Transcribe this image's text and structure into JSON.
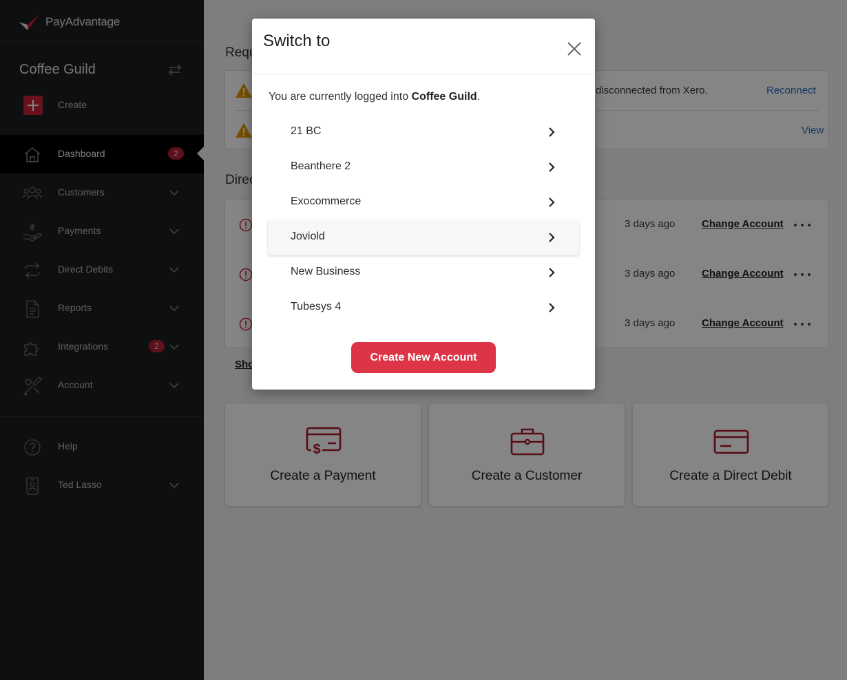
{
  "colors": {
    "sidebar_bg": "#1c1d20",
    "brand_red": "#c8243a",
    "button_red": "#dd3447",
    "link_blue": "#2f6ec1",
    "warning_orange": "#e39a00"
  },
  "sidebar": {
    "logo_text": "PayAdvantage",
    "business_name": "Coffee Guild",
    "create_label": "Create",
    "items": [
      {
        "label": "Dashboard",
        "icon": "home-icon",
        "badge": "2",
        "active": true
      },
      {
        "label": "Customers",
        "icon": "users-icon"
      },
      {
        "label": "Payments",
        "icon": "payment-hand-icon"
      },
      {
        "label": "Direct Debits",
        "icon": "repeat-icon"
      },
      {
        "label": "Reports",
        "icon": "document-icon"
      },
      {
        "label": "Integrations",
        "icon": "puzzle-icon",
        "badge": "2"
      },
      {
        "label": "Account",
        "icon": "tools-icon"
      },
      {
        "label": "Help",
        "icon": "help-icon"
      },
      {
        "label": "Ted Lasso",
        "icon": "user-badge-icon"
      }
    ]
  },
  "main": {
    "requires_title": "Requ",
    "requires_rows": [
      {
        "text": "disconnected from Xero.",
        "action": "Reconnect"
      },
      {
        "text": "",
        "action": "View"
      }
    ],
    "dd_title": "Direc",
    "dd_rows": [
      {
        "when": "3 days ago",
        "action": "Change Account"
      },
      {
        "when": "3 days ago",
        "action": "Change Account"
      },
      {
        "when": "3 days ago",
        "action": "Change Account"
      }
    ],
    "show_link": "Sho",
    "quick_actions": [
      {
        "label": "Create a Payment",
        "icon": "payment-card-icon"
      },
      {
        "label": "Create a Customer",
        "icon": "briefcase-icon"
      },
      {
        "label": "Create a Direct Debit",
        "icon": "credit-card-icon"
      }
    ]
  },
  "modal": {
    "title": "Switch to",
    "current_prefix": "You are currently logged into ",
    "current_business": "Coffee Guild",
    "current_suffix": ".",
    "accounts": [
      {
        "name": "21 BC"
      },
      {
        "name": "Beanthere 2"
      },
      {
        "name": "Exocommerce"
      },
      {
        "name": "Joviold"
      },
      {
        "name": "New Business"
      },
      {
        "name": "Tubesys 4"
      }
    ],
    "create_button": "Create New Account"
  }
}
